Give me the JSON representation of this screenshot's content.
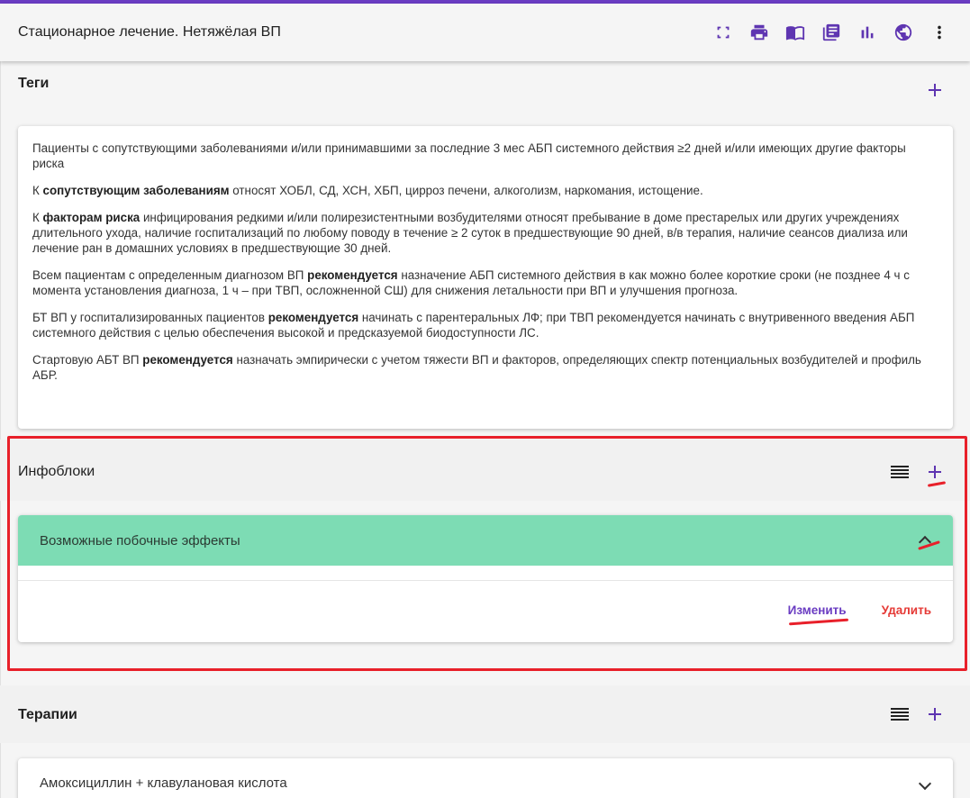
{
  "header": {
    "title": "Стационарное лечение. Нетяжёлая ВП",
    "icons": [
      "fullscreen-icon",
      "print-icon",
      "book-icon",
      "library-icon",
      "bar-chart-icon",
      "globe-icon",
      "more-vert-icon"
    ]
  },
  "tags": {
    "title": "Теги"
  },
  "description": {
    "p1": "Пациенты с сопутствующими заболеваниями и/или принимавшими за последние 3 мес АБП системного действия ≥2 дней и/или имеющих другие факторы риска",
    "p2_pre": "К ",
    "p2_bold": "сопутствующим заболеваниям",
    "p2_post": " относят ХОБЛ, СД, ХСН, ХБП, цирроз печени, алкоголизм, наркомания, истощение.",
    "p3_pre": "К ",
    "p3_bold": "факторам риска",
    "p3_post": " инфицирования редкими и/или полирезистентными возбудителями относят пребывание в доме престарелых или других учреждениях длительного ухода, наличие госпитализаций по любому поводу в течение ≥ 2 суток в предшествующие 90 дней, в/в терапия, наличие сеансов диализа или лечение ран в домашних условиях в предшествующие 30 дней.",
    "p4_pre": "Всем пациентам с определенным диагнозом ВП ",
    "p4_bold": "рекомендуется",
    "p4_post": " назначение АБП системного действия в как можно более короткие сроки (не позднее 4 ч с момента установления диагноза, 1 ч – при ТВП, осложненной СШ) для снижения летальности при ВП и улучшения прогноза.",
    "p5_pre": "БТ ВП у госпитализированных пациентов ",
    "p5_bold": "рекомендуется",
    "p5_post": " начинать с парентеральных ЛФ; при ТВП рекомендуется начинать с внутривенного введения АБП системного действия с целью обеспечения высокой и предсказуемой биодоступности ЛС.",
    "p6_pre": "Стартовую АБТ ВП ",
    "p6_bold": "рекомендуется",
    "p6_post": " назначать эмпирически с учетом тяжести ВП и факторов, определяющих спектр потенциальных возбудителей и профиль АБР."
  },
  "infoblocks": {
    "title": "Инфоблоки",
    "item": {
      "title": "Возможные побочные эффекты",
      "edit_label": "Изменить",
      "delete_label": "Удалить",
      "header_color": "#7ddcb4"
    }
  },
  "therapies": {
    "title": "Терапии",
    "items": [
      {
        "label": "Амоксициллин + клавулановая кислота"
      }
    ]
  },
  "colors": {
    "accent": "#5e35b1",
    "highlight": "#e8202a",
    "delete": "#e53935"
  }
}
